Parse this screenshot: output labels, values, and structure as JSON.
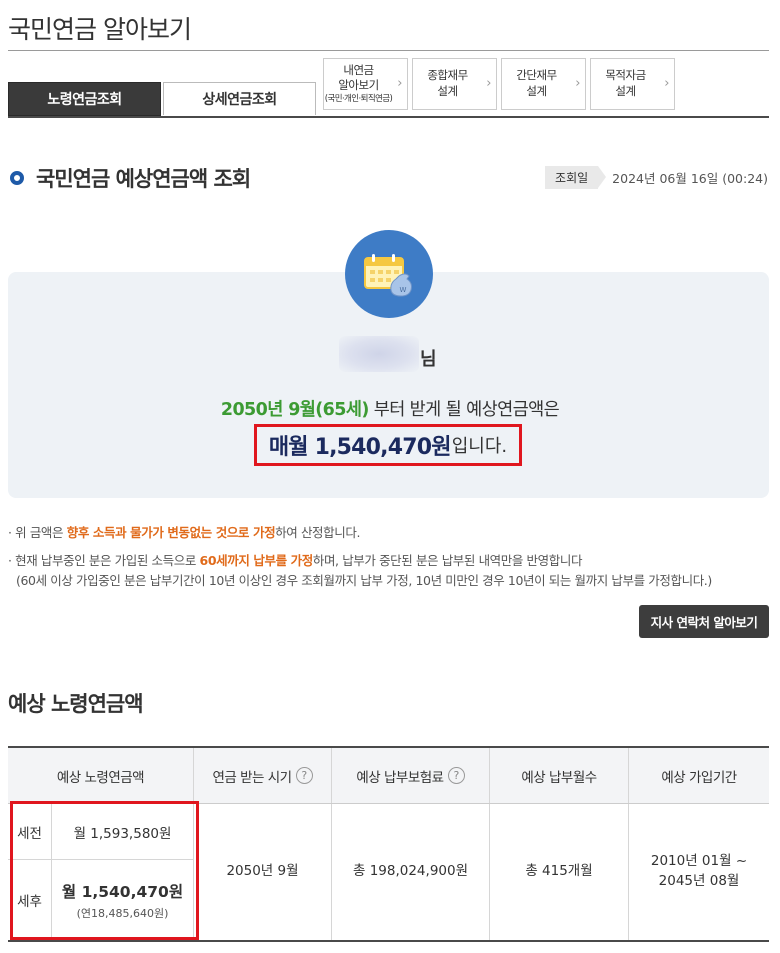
{
  "page": {
    "title": "국민연금 알아보기"
  },
  "tabs": {
    "active": "노령연금조회",
    "inactive": "상세연금조회"
  },
  "quick_links": [
    {
      "line1": "내연금",
      "line2": "알아보기",
      "small": "(국민·개인·퇴직연금)"
    },
    {
      "line1": "종합재무",
      "line2": "설계"
    },
    {
      "line1": "간단재무",
      "line2": "설계"
    },
    {
      "line1": "목적자금",
      "line2": "설계"
    }
  ],
  "section": {
    "title": "국민연금 예상연금액 조회",
    "date_label": "조회일",
    "date_value": "2024년 06월 16일 (00:24)"
  },
  "summary": {
    "name_suffix": "님",
    "start_green": "2050년 9월(65세)",
    "start_rest": " 부터 받게 될 예상연금액은",
    "amount": "매월 1,540,470원",
    "amount_tail": "입니다."
  },
  "notes": {
    "n1_pre": "위 금액은 ",
    "n1_orange": "향후 소득과 물가가 변동없는 것으로 가정",
    "n1_post": "하여 산정합니다.",
    "n2_pre": "현재 납부중인 분은 가입된 소득으로 ",
    "n2_orange": "60세까지 납부를 가정",
    "n2_post": "하며, 납부가 중단된 분은 납부된 내역만을 반영합니다",
    "n2_sub": "(60세 이상 가입중인 분은 납부기간이 10년 이상인 경우 조회월까지 납부 가정, 10년 미만인 경우 10년이 되는 월까지 납부를 가정합니다.)"
  },
  "contact_button": "지사 연락처 알아보기",
  "table_section": {
    "title": "예상 노령연금액",
    "headers": [
      "예상 노령연금액",
      "연금 받는 시기",
      "예상 납부보험료",
      "예상 납부월수",
      "예상 가입기간"
    ],
    "qmark": "?",
    "pre_tax_label": "세전",
    "pre_tax_value": "월 1,593,580원",
    "post_tax_label": "세후",
    "post_tax_value": "월 1,540,470원",
    "post_tax_annual": "(연18,485,640원)",
    "start_time": "2050년 9월",
    "premium": "총 198,024,900원",
    "months": "총 415개월",
    "period_start": "2010년 01월 ~",
    "period_end": "2045년 08월"
  }
}
